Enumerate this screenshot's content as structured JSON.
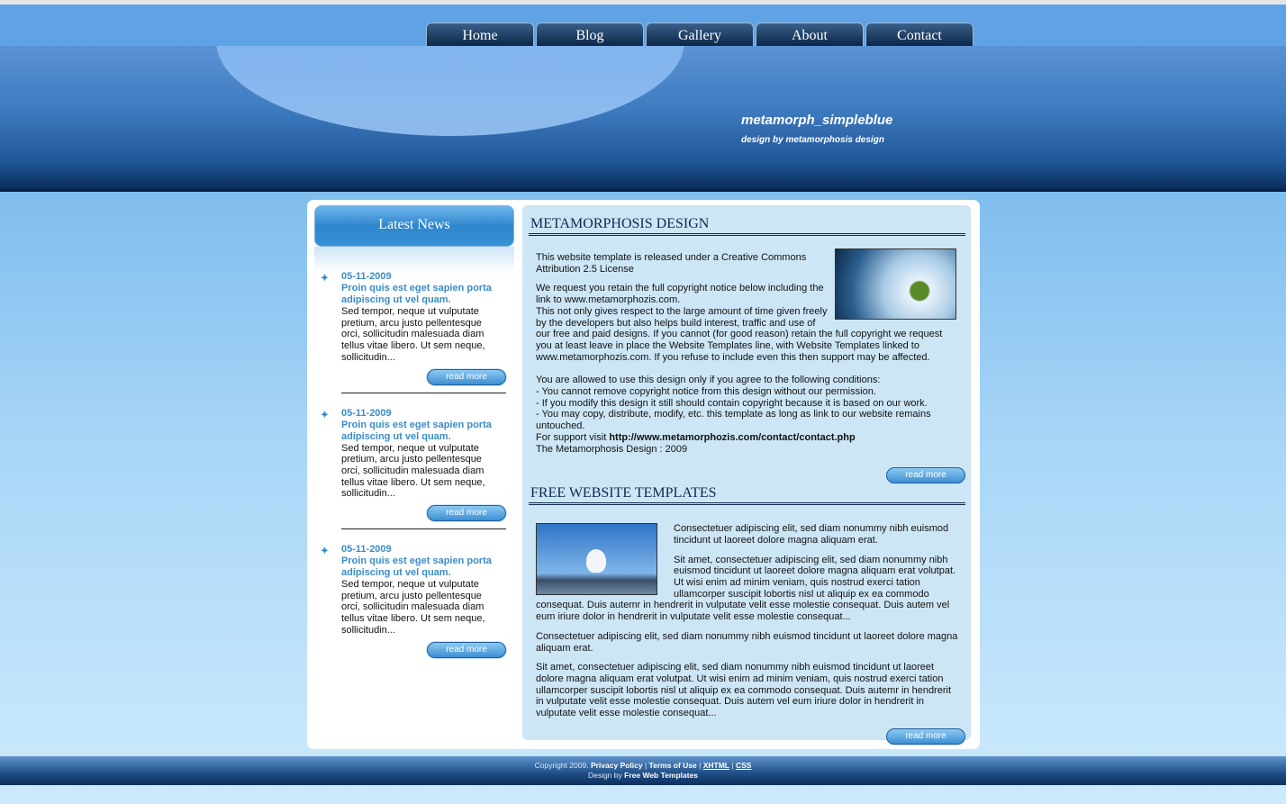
{
  "nav": [
    "Home",
    "Blog",
    "Gallery",
    "About",
    "Contact"
  ],
  "header": {
    "title": "metamorph_simpleblue",
    "subtitle": "design by metamorphosis design"
  },
  "latest_news": {
    "title": "Latest News",
    "items": [
      {
        "date": "05-11-2009",
        "title": "Proin quis est eget sapien porta adipiscing ut vel quam.",
        "body": "Sed tempor, neque ut vulputate pretium, arcu justo pellentesque orci, sollicitudin malesuada diam tellus vitae libero. Ut sem neque, sollicitudin...",
        "read_more": "read more"
      },
      {
        "date": "05-11-2009",
        "title": "Proin quis est eget sapien porta adipiscing ut vel quam.",
        "body": "Sed tempor, neque ut vulputate pretium, arcu justo pellentesque orci, sollicitudin malesuada diam tellus vitae libero. Ut sem neque, sollicitudin...",
        "read_more": "read more"
      },
      {
        "date": "05-11-2009",
        "title": "Proin quis est eget sapien porta adipiscing ut vel quam.",
        "body": "Sed tempor, neque ut vulputate pretium, arcu justo pellentesque orci, sollicitudin malesuada diam tellus vitae libero. Ut sem neque, sollicitudin...",
        "read_more": "read more"
      }
    ]
  },
  "section1": {
    "title": "METAMORPHOSIS DESIGN",
    "p1": "This website template is released under a Creative Commons Attribution 2.5 License",
    "p2": "We request you retain the full copyright notice below including the link to www.metamorphozis.com.",
    "p3": "This not only gives respect to the large amount of time given freely by the developers but also helps build interest, traffic and use of our free and paid designs. If you cannot (for good reason) retain the full copyright we request you at least leave in place the Website Templates line, with Website Templates linked to www.metamorphozis.com. If you refuse to include even this then support may be affected.",
    "conditions_intro": "You are allowed to use this design only if you agree to the following conditions:",
    "conditions": [
      "- You cannot remove copyright notice from this design without our permission.",
      "- If you modify this design it still should contain copyright because it is based on our work.",
      "- You may copy, distribute, modify, etc. this template as long as link to our website remains untouched."
    ],
    "support_prefix": "For support visit ",
    "support_link": "http://www.metamorphozis.com/contact/contact.php",
    "signoff": "The Metamorphosis Design : 2009",
    "read_more": "read more"
  },
  "section2": {
    "title": "FREE WEBSITE TEMPLATES",
    "p1": "Consectetuer adipiscing elit, sed diam nonummy nibh euismod tincidunt ut laoreet dolore magna aliquam erat.",
    "p2": "Sit amet, consectetuer adipiscing elit, sed diam nonummy nibh euismod tincidunt ut laoreet dolore magna aliquam erat volutpat. Ut wisi enim ad minim veniam, quis nostrud exerci tation ullamcorper suscipit lobortis nisl ut aliquip ex ea commodo consequat. Duis autemr in hendrerit in vulputate velit esse molestie consequat. Duis autem vel eum iriure dolor in hendrerit in vulputate velit esse molestie consequat...",
    "p3": "Consectetuer adipiscing elit, sed diam nonummy nibh euismod tincidunt ut laoreet dolore magna aliquam erat.",
    "p4": "Sit amet, consectetuer adipiscing elit, sed diam nonummy nibh euismod tincidunt ut laoreet dolore magna aliquam erat volutpat. Ut wisi enim ad minim veniam, quis nostrud exerci tation ullamcorper suscipit lobortis nisl ut aliquip ex ea commodo consequat. Duis autemr in hendrerit in vulputate velit esse molestie consequat. Duis autem vel eum iriure dolor in hendrerit in vulputate velit esse molestie consequat...",
    "read_more": "read more"
  },
  "footer": {
    "copyright": "Copyright 2009.",
    "privacy": "Privacy Policy",
    "terms": "Terms of Use",
    "xhtml": "XHTML",
    "css": "CSS",
    "design_by": "Design by",
    "design_link": "Free Web Templates"
  }
}
